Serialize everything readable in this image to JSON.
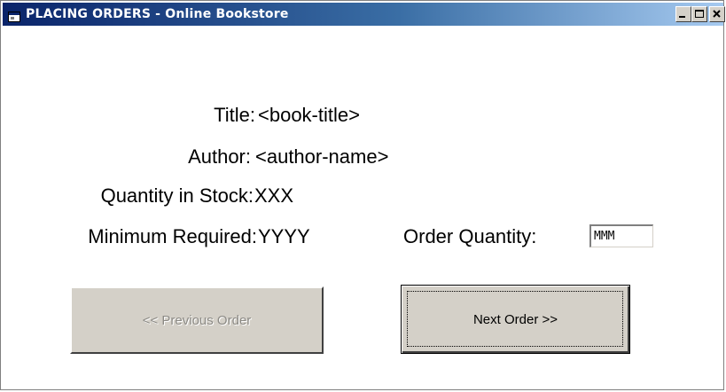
{
  "window": {
    "title": "PLACING ORDERS  - Online Bookstore",
    "icon": "app-window-icon",
    "controls": {
      "minimize": "minimize-icon",
      "maximize": "maximize-icon",
      "close": "close-icon"
    }
  },
  "fields": {
    "title": {
      "label": "Title:",
      "value": "<book-title>"
    },
    "author": {
      "label": "Author:",
      "value": "<author-name>"
    },
    "stock": {
      "label": "Quantity in Stock:",
      "value": "XXX"
    },
    "minimum": {
      "label": "Minimum Required:",
      "value": "YYYY"
    },
    "order_quantity": {
      "label": "Order Quantity:",
      "value": "MMM"
    }
  },
  "buttons": {
    "previous": {
      "label": "<< Previous Order",
      "enabled": false
    },
    "next": {
      "label": "Next Order >>",
      "enabled": true,
      "focused": true
    }
  },
  "colors": {
    "titlebar_start": "#0a246a",
    "titlebar_end": "#a6caf0",
    "button_face": "#d4d0c8",
    "disabled_text": "#8c8a85"
  }
}
